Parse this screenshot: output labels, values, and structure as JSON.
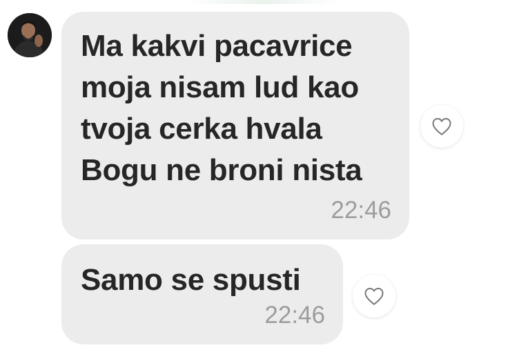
{
  "messages": [
    {
      "text": "Ma kakvi pacavrice\nmoja nisam lud kao\ntvoja cerka hvala\nBogu ne broni nista",
      "time": "22:46"
    },
    {
      "text": "Samo se spusti",
      "time": "22:46"
    }
  ],
  "icons": {
    "avatar": "avatar",
    "reaction": "heart-outline-icon"
  },
  "colors": {
    "bubble": "#ececec",
    "text": "#262626",
    "timestamp": "#9c9c9c",
    "background": "#ffffff"
  }
}
